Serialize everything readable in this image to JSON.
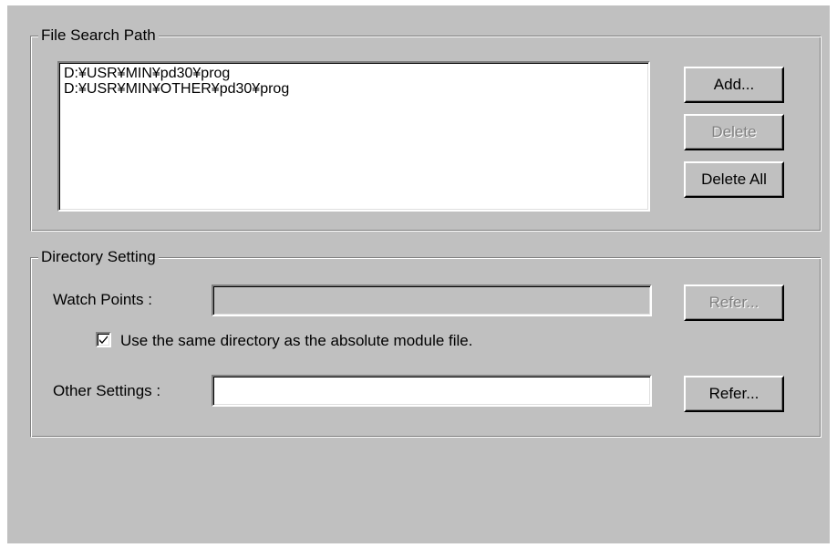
{
  "file_search_path": {
    "title": "File Search Path",
    "paths": [
      "D:¥USR¥MIN¥pd30¥prog",
      "D:¥USR¥MIN¥OTHER¥pd30¥prog"
    ],
    "add_label": "Add...",
    "delete_label": "Delete",
    "delete_all_label": "Delete All"
  },
  "directory_setting": {
    "title": "Directory Setting",
    "watch_points_label": "Watch Points :",
    "watch_points_value": "",
    "watch_points_refer_label": "Refer...",
    "same_dir_checked": true,
    "same_dir_label": "Use the same directory as the absolute module file.",
    "other_settings_label": "Other Settings :",
    "other_settings_value": "",
    "other_settings_refer_label": "Refer..."
  },
  "colors": {
    "dialog_bg": "#c0c0c0",
    "disabled_text": "#808080"
  },
  "icons": {
    "checkbox_mark": "checkmark-icon"
  }
}
